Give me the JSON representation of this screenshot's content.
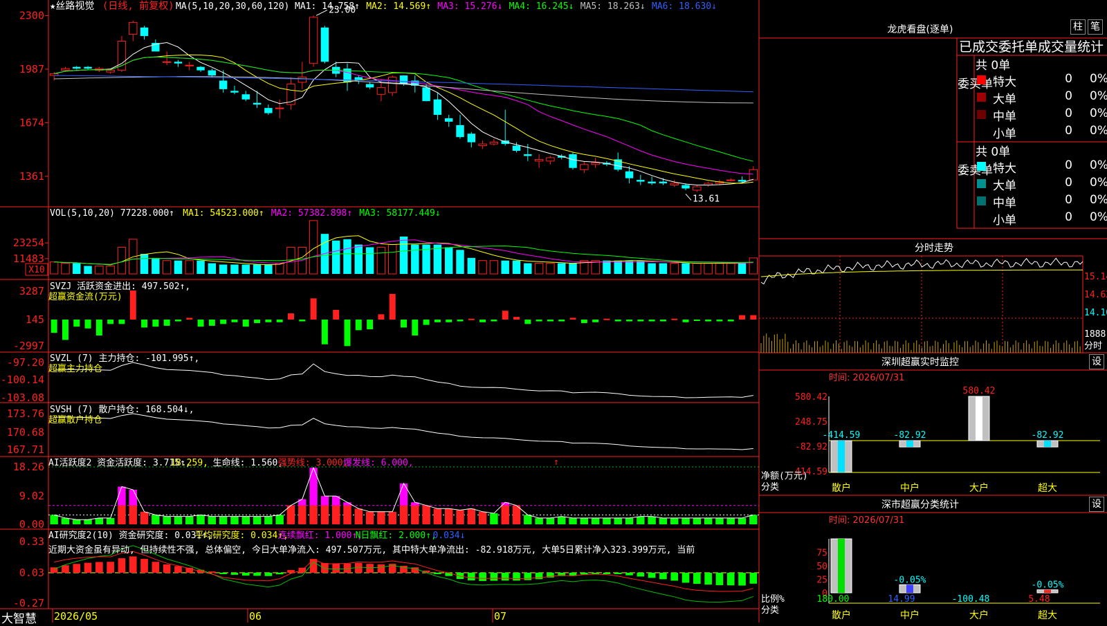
{
  "app": {
    "logo": "大智慧"
  },
  "stock": {
    "star": "★",
    "name": "丝路视觉",
    "period": "(日线, 前复权)"
  },
  "ma_header": {
    "prefix": "MA(5,10,20,30,60,120)",
    "items": [
      {
        "label": "MA1:",
        "value": "14.758",
        "arrow": "↑",
        "color": "#ffffff"
      },
      {
        "label": "MA2:",
        "value": "14.569",
        "arrow": "↑",
        "color": "#ffff00"
      },
      {
        "label": "MA3:",
        "value": "15.276",
        "arrow": "↓",
        "color": "#ff00ff"
      },
      {
        "label": "MA4:",
        "value": "16.245",
        "arrow": "↓",
        "color": "#00ff00"
      },
      {
        "label": "MA5:",
        "value": "18.263",
        "arrow": "↓",
        "color": "#c0c0c0"
      },
      {
        "label": "MA6:",
        "value": "18.630",
        "arrow": "↓",
        "color": "#3060ff"
      }
    ]
  },
  "price_axis": [
    "2300",
    "1987",
    "1674",
    "1361"
  ],
  "price_marks": {
    "high": "23.00",
    "low": "13.61"
  },
  "vol_header": {
    "prefix": "VOL(5,10,20)",
    "value": "77228.000↑",
    "items": [
      {
        "text": "MA1: 54523.000↑",
        "color": "#ffff00"
      },
      {
        "text": "MA2: 57382.898↑",
        "color": "#ff00ff"
      },
      {
        "text": "MA3: 58177.449↓",
        "color": "#00ff00"
      }
    ]
  },
  "vol_axis": [
    "23254",
    "11483"
  ],
  "vol_unit": "X10",
  "svzj": {
    "header": "SVZJ  活跃资金进出: 497.502↑,",
    "sub": "超赢资金流(万元)",
    "axis": [
      "3287",
      "145",
      "-2997"
    ]
  },
  "svzl": {
    "header": "SVZL (7) 主力持仓: -101.995↑,",
    "sub": "超赢主力持仓",
    "axis": [
      "-97.20",
      "-100.14",
      "-103.08"
    ]
  },
  "svsh": {
    "header": "SVSH (7) 散户持仓: 168.504↓,",
    "sub": "超赢散户持仓",
    "axis": [
      "173.76",
      "170.68",
      "167.71"
    ]
  },
  "ai_active": {
    "items": [
      {
        "text": "AI活跃度2 资金活跃度: 3.715↑,",
        "color": "#ffffff"
      },
      {
        "text": "18.259,",
        "color": "#ffff00"
      },
      {
        "text": "生命线: 1.560,",
        "color": "#ffffff"
      },
      {
        "text": "强势线: 3.000,",
        "color": "#ff2020"
      },
      {
        "text": "爆发线: 6.000,",
        "color": "#ff00ff"
      }
    ],
    "axis": [
      "18.26",
      "9.02",
      "0.00"
    ]
  },
  "ai_research": {
    "items": [
      {
        "text": "AI研究度2(10) 资金研究度: 0.031↑,",
        "color": "#ffffff"
      },
      {
        "text": "平均研究度: 0.034↑,",
        "color": "#ffff00"
      },
      {
        "text": "连续飘红: 1.000↑,",
        "color": "#ff00ff"
      },
      {
        "text": "N日飘红: 2.000↑,",
        "color": "#00ff00"
      },
      {
        "text": "0.034↓",
        "color": "#3060ff"
      }
    ],
    "comment": "近期大资金虽有异动, 但持续性不强, 总体偏空, 今日大单净流入: 497.507万元, 其中特大单净流出: -82.918万元, 大单5日累计净入323.399万元, 当前",
    "axis": [
      "0.33",
      "0.03",
      "-0.27"
    ]
  },
  "date_axis": [
    "2026/05",
    "06",
    "07"
  ],
  "longhu": {
    "title": "龙虎看盘(逐单)",
    "btn_zhu": "柱",
    "btn_bi": "笔",
    "tabs": "已成交委托单成交量统计",
    "buy": {
      "side": "委买单",
      "total": "共 0单",
      "rows": [
        {
          "name": "特大",
          "count": "0",
          "pct": "0%",
          "color": "#ff0000"
        },
        {
          "name": "大单",
          "count": "0",
          "pct": "0%",
          "color": "#a00000"
        },
        {
          "name": "中单",
          "count": "0",
          "pct": "0%",
          "color": "#700000"
        },
        {
          "name": "小单",
          "count": "0",
          "pct": "0%",
          "color": ""
        }
      ]
    },
    "sell": {
      "side": "委卖单",
      "total": "共 0单",
      "rows": [
        {
          "name": "特大",
          "count": "0",
          "pct": "0%",
          "color": "#00ffff"
        },
        {
          "name": "大单",
          "count": "0",
          "pct": "0%",
          "color": "#009090"
        },
        {
          "name": "中单",
          "count": "0",
          "pct": "0%",
          "color": "#007070"
        },
        {
          "name": "小单",
          "count": "0",
          "pct": "0%",
          "color": ""
        }
      ]
    }
  },
  "intraday": {
    "title": "分时走势",
    "axis": [
      "15.14",
      "14.62",
      "14.10"
    ],
    "vol_label": "1888",
    "unit": "分时"
  },
  "szmonitor": {
    "title": "深圳超赢实时监控",
    "set": "设",
    "time": "时间: 2026/07/31",
    "axis": [
      "580.42",
      "248.75",
      "-82.92",
      "-414.59"
    ],
    "ylabel": "净额(万元)",
    "xlabel": "分类",
    "categories": [
      "散户",
      "中户",
      "大户",
      "超大"
    ],
    "values": [
      -414.59,
      -82.92,
      580.42,
      -82.92
    ],
    "value_labels": [
      "-414.59",
      "-82.92",
      "580.42",
      "-82.92"
    ]
  },
  "szstats": {
    "title": "深市超赢分类统计",
    "set": "设",
    "time": "时间: 2026/07/31",
    "axis": [
      "75",
      "50",
      "25",
      "0"
    ],
    "ylabel": "比例%",
    "xlabel": "分类",
    "categories": [
      "散户",
      "中户",
      "大户",
      "超大"
    ],
    "bar_pct": [
      100,
      15,
      0,
      5.5
    ],
    "bottom_values": [
      "180.00",
      "14.99",
      "-100.48",
      "5.48"
    ],
    "bar_labels": [
      "",
      "-0.05%",
      "",
      "-0.05%"
    ]
  },
  "chart_data": {
    "type": "candlestick",
    "title": "丝路视觉 (日线, 前复权)",
    "yunit": "price",
    "ylim": [
      13.0,
      23.3
    ],
    "candles": [
      [
        19.5,
        19.7,
        19.2,
        19.6
      ],
      [
        19.8,
        20.0,
        19.7,
        19.9
      ],
      [
        20.0,
        20.05,
        19.85,
        19.9
      ],
      [
        20.0,
        20.05,
        19.8,
        19.9
      ],
      [
        19.8,
        20.0,
        19.7,
        19.9
      ],
      [
        19.7,
        19.9,
        19.6,
        19.8
      ],
      [
        19.8,
        21.8,
        19.7,
        21.5
      ],
      [
        21.9,
        22.7,
        21.5,
        22.6
      ],
      [
        22.3,
        22.4,
        21.6,
        21.8
      ],
      [
        21.4,
        21.6,
        20.9,
        20.9
      ],
      [
        20.3,
        20.9,
        20.1,
        20.3
      ],
      [
        20.3,
        20.4,
        20.0,
        20.2
      ],
      [
        20.1,
        20.3,
        19.8,
        20.1
      ],
      [
        20.0,
        20.05,
        19.7,
        19.8
      ],
      [
        19.8,
        19.9,
        19.4,
        19.5
      ],
      [
        19.2,
        19.8,
        18.5,
        18.7
      ],
      [
        18.6,
        18.9,
        18.4,
        18.5
      ],
      [
        18.4,
        18.6,
        18.0,
        18.1
      ],
      [
        17.9,
        18.6,
        17.6,
        17.8
      ],
      [
        17.6,
        17.8,
        17.2,
        17.3
      ],
      [
        17.6,
        18.1,
        17.0,
        17.6
      ],
      [
        17.8,
        19.4,
        17.5,
        19.0
      ],
      [
        19.1,
        20.3,
        18.7,
        19.4
      ],
      [
        20.2,
        23.0,
        20.0,
        22.9
      ],
      [
        22.3,
        22.4,
        20.2,
        20.3
      ],
      [
        20.0,
        20.3,
        19.4,
        19.6
      ],
      [
        19.9,
        20.2,
        18.6,
        19.1
      ],
      [
        19.4,
        19.5,
        19.0,
        19.2
      ],
      [
        19.0,
        19.1,
        18.7,
        18.8
      ],
      [
        18.4,
        19.3,
        18.0,
        18.8
      ],
      [
        18.5,
        19.5,
        18.3,
        19.4
      ],
      [
        19.5,
        19.5,
        18.9,
        19.0
      ],
      [
        19.2,
        19.5,
        18.5,
        18.9
      ],
      [
        18.8,
        19.0,
        18.0,
        18.0
      ],
      [
        18.1,
        18.5,
        16.9,
        17.2
      ],
      [
        17.0,
        17.2,
        16.5,
        16.8
      ],
      [
        16.6,
        17.2,
        15.8,
        15.9
      ],
      [
        16.1,
        16.2,
        15.3,
        15.6
      ],
      [
        15.4,
        15.7,
        15.2,
        15.5
      ],
      [
        15.5,
        15.8,
        15.4,
        15.6
      ],
      [
        15.7,
        17.5,
        15.4,
        15.5
      ],
      [
        15.4,
        15.6,
        15.0,
        15.1
      ],
      [
        14.9,
        15.5,
        14.5,
        14.8
      ],
      [
        14.5,
        14.9,
        14.1,
        14.6
      ],
      [
        14.5,
        14.8,
        14.3,
        14.7
      ],
      [
        14.8,
        14.9,
        14.6,
        14.7
      ],
      [
        14.9,
        15.0,
        14.0,
        14.1
      ],
      [
        14.0,
        14.5,
        13.8,
        14.3
      ],
      [
        14.3,
        14.7,
        14.1,
        14.4
      ],
      [
        14.4,
        14.5,
        14.2,
        14.3
      ],
      [
        14.6,
        15.0,
        13.9,
        14.0
      ],
      [
        13.9,
        14.2,
        13.2,
        13.5
      ],
      [
        13.4,
        13.7,
        13.1,
        13.3
      ],
      [
        13.3,
        13.6,
        13.1,
        13.2
      ],
      [
        13.3,
        13.5,
        13.1,
        13.2
      ],
      [
        13.1,
        13.4,
        13.0,
        13.2
      ],
      [
        13.1,
        13.2,
        12.8,
        12.9
      ],
      [
        12.8,
        13.1,
        12.7,
        13.0
      ],
      [
        13.1,
        13.3,
        13.0,
        13.2
      ],
      [
        13.2,
        13.4,
        13.1,
        13.3
      ],
      [
        13.4,
        13.5,
        13.3,
        13.4
      ],
      [
        13.4,
        13.6,
        13.2,
        13.3
      ],
      [
        13.4,
        14.2,
        13.4,
        14.0
      ]
    ],
    "volume": [
      9,
      8,
      8,
      6,
      6,
      6,
      20,
      26,
      15,
      12,
      10,
      10,
      10,
      10,
      8,
      7,
      7,
      7,
      7,
      7,
      8,
      20,
      20,
      40,
      30,
      25,
      26,
      22,
      20,
      20,
      22,
      28,
      22,
      22,
      22,
      20,
      18,
      12,
      10,
      10,
      10,
      10,
      8,
      8,
      8,
      8,
      8,
      10,
      10,
      10,
      10,
      10,
      10,
      8,
      8,
      8,
      8,
      8,
      8,
      8,
      8,
      8,
      12
    ],
    "svzj_flow": [
      -1500,
      -2300,
      -800,
      -1000,
      -1800,
      -500,
      -500,
      3287,
      -900,
      -800,
      -700,
      -200,
      200,
      -800,
      -700,
      -500,
      -300,
      -800,
      -400,
      -300,
      -300,
      700,
      -200,
      2400,
      -2800,
      1100,
      -3000,
      -1200,
      -1100,
      600,
      2900,
      -900,
      -1800,
      -600,
      -300,
      -300,
      -200,
      100,
      -300,
      -200,
      1000,
      300,
      -500,
      -200,
      -200,
      -200,
      200,
      -400,
      -300,
      100,
      -200,
      -200,
      -200,
      -200,
      -200,
      100,
      -300,
      -100,
      -200,
      -200,
      -200,
      500,
      500
    ],
    "active_bars": [
      3,
      2,
      1.5,
      1.5,
      2,
      2,
      12,
      11,
      4,
      3,
      2.5,
      2.5,
      2.5,
      3,
      2.5,
      2.5,
      2.5,
      2.5,
      2.5,
      2.5,
      3,
      6,
      8,
      18,
      9,
      9,
      7,
      5,
      4,
      4,
      4,
      13,
      7,
      6,
      5,
      5,
      4.5,
      5,
      4,
      3.5,
      7,
      6,
      3,
      2,
      2,
      2.5,
      2,
      2,
      2,
      2,
      2,
      2,
      2.5,
      2.5,
      2,
      2,
      2,
      2,
      2,
      2,
      2,
      2,
      3
    ]
  }
}
